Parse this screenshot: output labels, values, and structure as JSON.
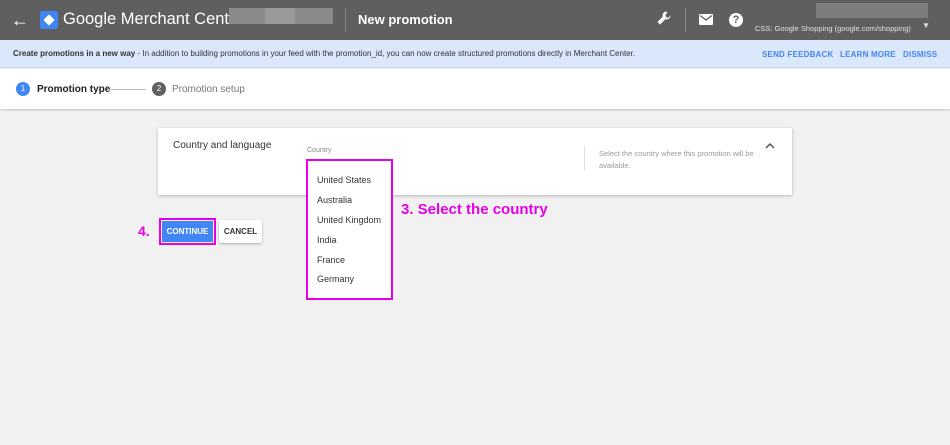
{
  "topbar": {
    "brand": "Google Merchant Center",
    "title": "New promotion",
    "account_line": "CSS: Google Shopping (google.com/shopping)",
    "icons": [
      "back-arrow-icon",
      "merchant-center-logo-icon",
      "wrench-icon",
      "mail-icon",
      "help-icon",
      "dropdown-caret-icon"
    ]
  },
  "banner": {
    "bold_text": "Create promotions in a new way",
    "text": " - In addition to building promotions in your feed with the promotion_id, you can now create structured promotions directly in Merchant Center.",
    "links": [
      "SEND FEEDBACK",
      "LEARN MORE",
      "DISMISS"
    ]
  },
  "stepper": {
    "steps": [
      {
        "num": "1",
        "label": "Promotion type"
      },
      {
        "num": "2",
        "label": "Promotion setup"
      }
    ]
  },
  "card": {
    "title": "Country and language",
    "field_label": "Country",
    "help_text": "Select the country where this promotion will be available."
  },
  "dropdown": {
    "options": [
      "United States",
      "Australia",
      "United Kingdom",
      "India",
      "France",
      "Germany"
    ]
  },
  "annotations": {
    "select_country": "3. Select the country",
    "step4": "4."
  },
  "buttons": {
    "continue": "CONTINUE",
    "cancel": "CANCEL"
  },
  "colors": {
    "topbar": "#5f5f5f",
    "banner": "#dbe7fb",
    "accent": "#4285f4",
    "annotation": "#e600e6"
  }
}
